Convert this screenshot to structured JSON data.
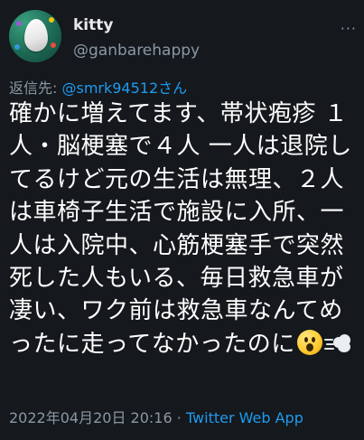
{
  "author": {
    "display_name": "kitty",
    "handle": "@ganbarehappy",
    "avatar_icon": "egg-avatar-icon"
  },
  "more_options_label": "···",
  "reply_to": {
    "prefix": "返信先: ",
    "mention": "@smrk94512さん"
  },
  "tweet": {
    "text": "確かに増えてます、帯状疱疹 １人・脳梗塞で４人 一人は退院してるけど元の生活は無理、２人は車椅子生活で施設に入所、一人は入院中、心筋梗塞手で突然死した人もいる、毎日救急車が凄い、ワク前は救急車なんてめったに走ってなかったのに",
    "trailing_emoji": [
      "astonished-face-icon",
      "dashing-away-icon"
    ]
  },
  "meta": {
    "timestamp": "2022年04月20日 20:16",
    "separator": " · ",
    "source": "Twitter Web App"
  },
  "colors": {
    "background": "#15181c",
    "text_primary": "#e7e9ea",
    "text_secondary": "#8b98a5",
    "link": "#1d9bf0"
  }
}
